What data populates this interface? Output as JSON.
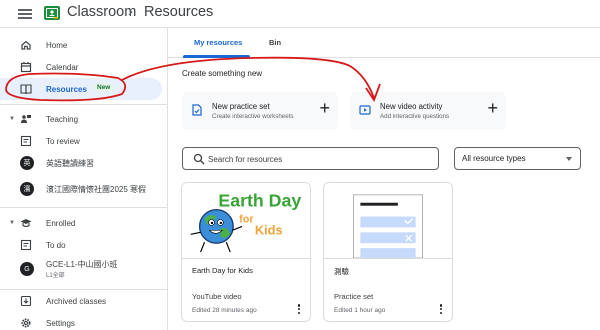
{
  "header": {
    "app_title": "Classroom",
    "separator": "›",
    "breadcrumb": "Resources",
    "colors": {
      "logo_green": "#1e8e3e",
      "accent_blue": "#1967d2"
    }
  },
  "sidebar": {
    "home": "Home",
    "calendar": "Calendar",
    "resources": "Resources",
    "resources_badge": "New",
    "teaching": "Teaching",
    "to_review": "To review",
    "class1_avatar": "英",
    "class1_name": "英語聽讀練習",
    "class2_avatar": "濱",
    "class2_name": "濱江國際情懷社團2025 寒假",
    "enrolled": "Enrolled",
    "to_do": "To do",
    "class3_avatar": "G",
    "class3_name": "GCE-L1-中山國小班",
    "class3_sub": "L1全部",
    "archived": "Archived classes",
    "settings": "Settings"
  },
  "tabs": {
    "my_resources": "My resources",
    "bin": "Bin"
  },
  "create": {
    "heading": "Create something new",
    "practice_title": "New practice set",
    "practice_sub": "Create interactive worksheets",
    "video_title": "New video activity",
    "video_sub": "Add interactive questions",
    "plus": "+"
  },
  "search": {
    "placeholder": "Search for resources"
  },
  "filter": {
    "selected": "All resource types"
  },
  "resources": [
    {
      "title": "Earth Day for Kids",
      "type": "YouTube video",
      "edited": "Edited 28 minutes ago",
      "thumb_text_1": "Earth Day",
      "thumb_text_2": "for",
      "thumb_text_3": "Kids"
    },
    {
      "title": "測驗",
      "type": "Practice set",
      "edited": "Edited 1 hour ago"
    }
  ]
}
